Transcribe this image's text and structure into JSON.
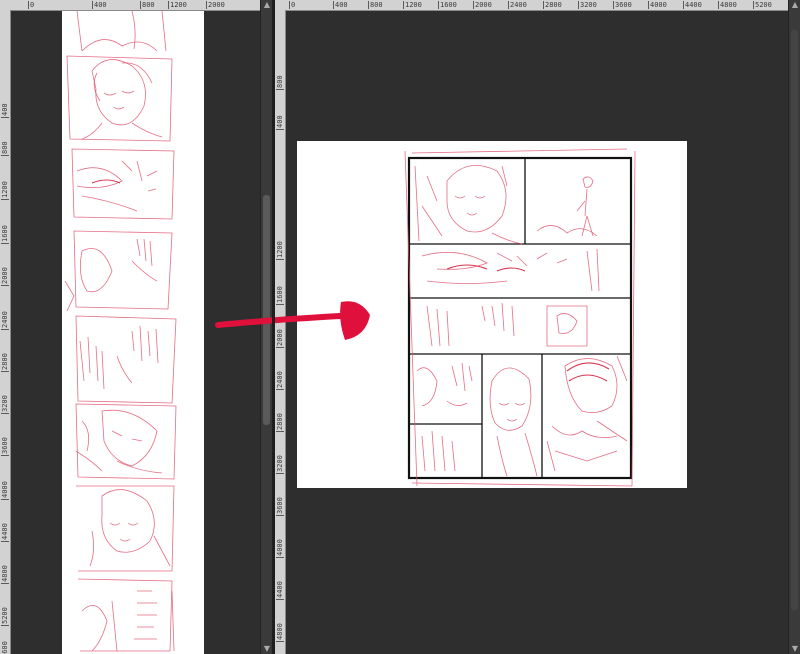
{
  "left_pane": {
    "ruler_top_ticks": [
      "0",
      "400",
      "800",
      "1200",
      "2000"
    ],
    "ruler_left_ticks": [
      "400",
      "800",
      "1200",
      "1600",
      "2000",
      "2400",
      "2800",
      "3200",
      "3600",
      "4000",
      "4400",
      "4800",
      "5200",
      "5600"
    ]
  },
  "right_pane": {
    "ruler_top_ticks": [
      "0",
      "400",
      "800",
      "1200",
      "1600",
      "2000",
      "2400",
      "2800",
      "3200",
      "3600",
      "4000",
      "4400",
      "4800",
      "5200"
    ],
    "ruler_left_ticks": [
      "400",
      "800",
      "1200",
      "1600",
      "2000",
      "2400",
      "2800",
      "3200",
      "3600",
      "4000",
      "4400",
      "4800",
      "5200",
      "5600"
    ]
  },
  "colors": {
    "sketch_red": "#e0556f",
    "arrow_red": "#e0103c",
    "panel_frame": "#111111",
    "canvas_bg": "#2e2e2e",
    "ruler_bg": "#d2d2d2"
  },
  "icons": {
    "arrow": "arrow-right-icon",
    "scroll_up": "chevron-up-icon",
    "scroll_down": "chevron-down-icon"
  }
}
